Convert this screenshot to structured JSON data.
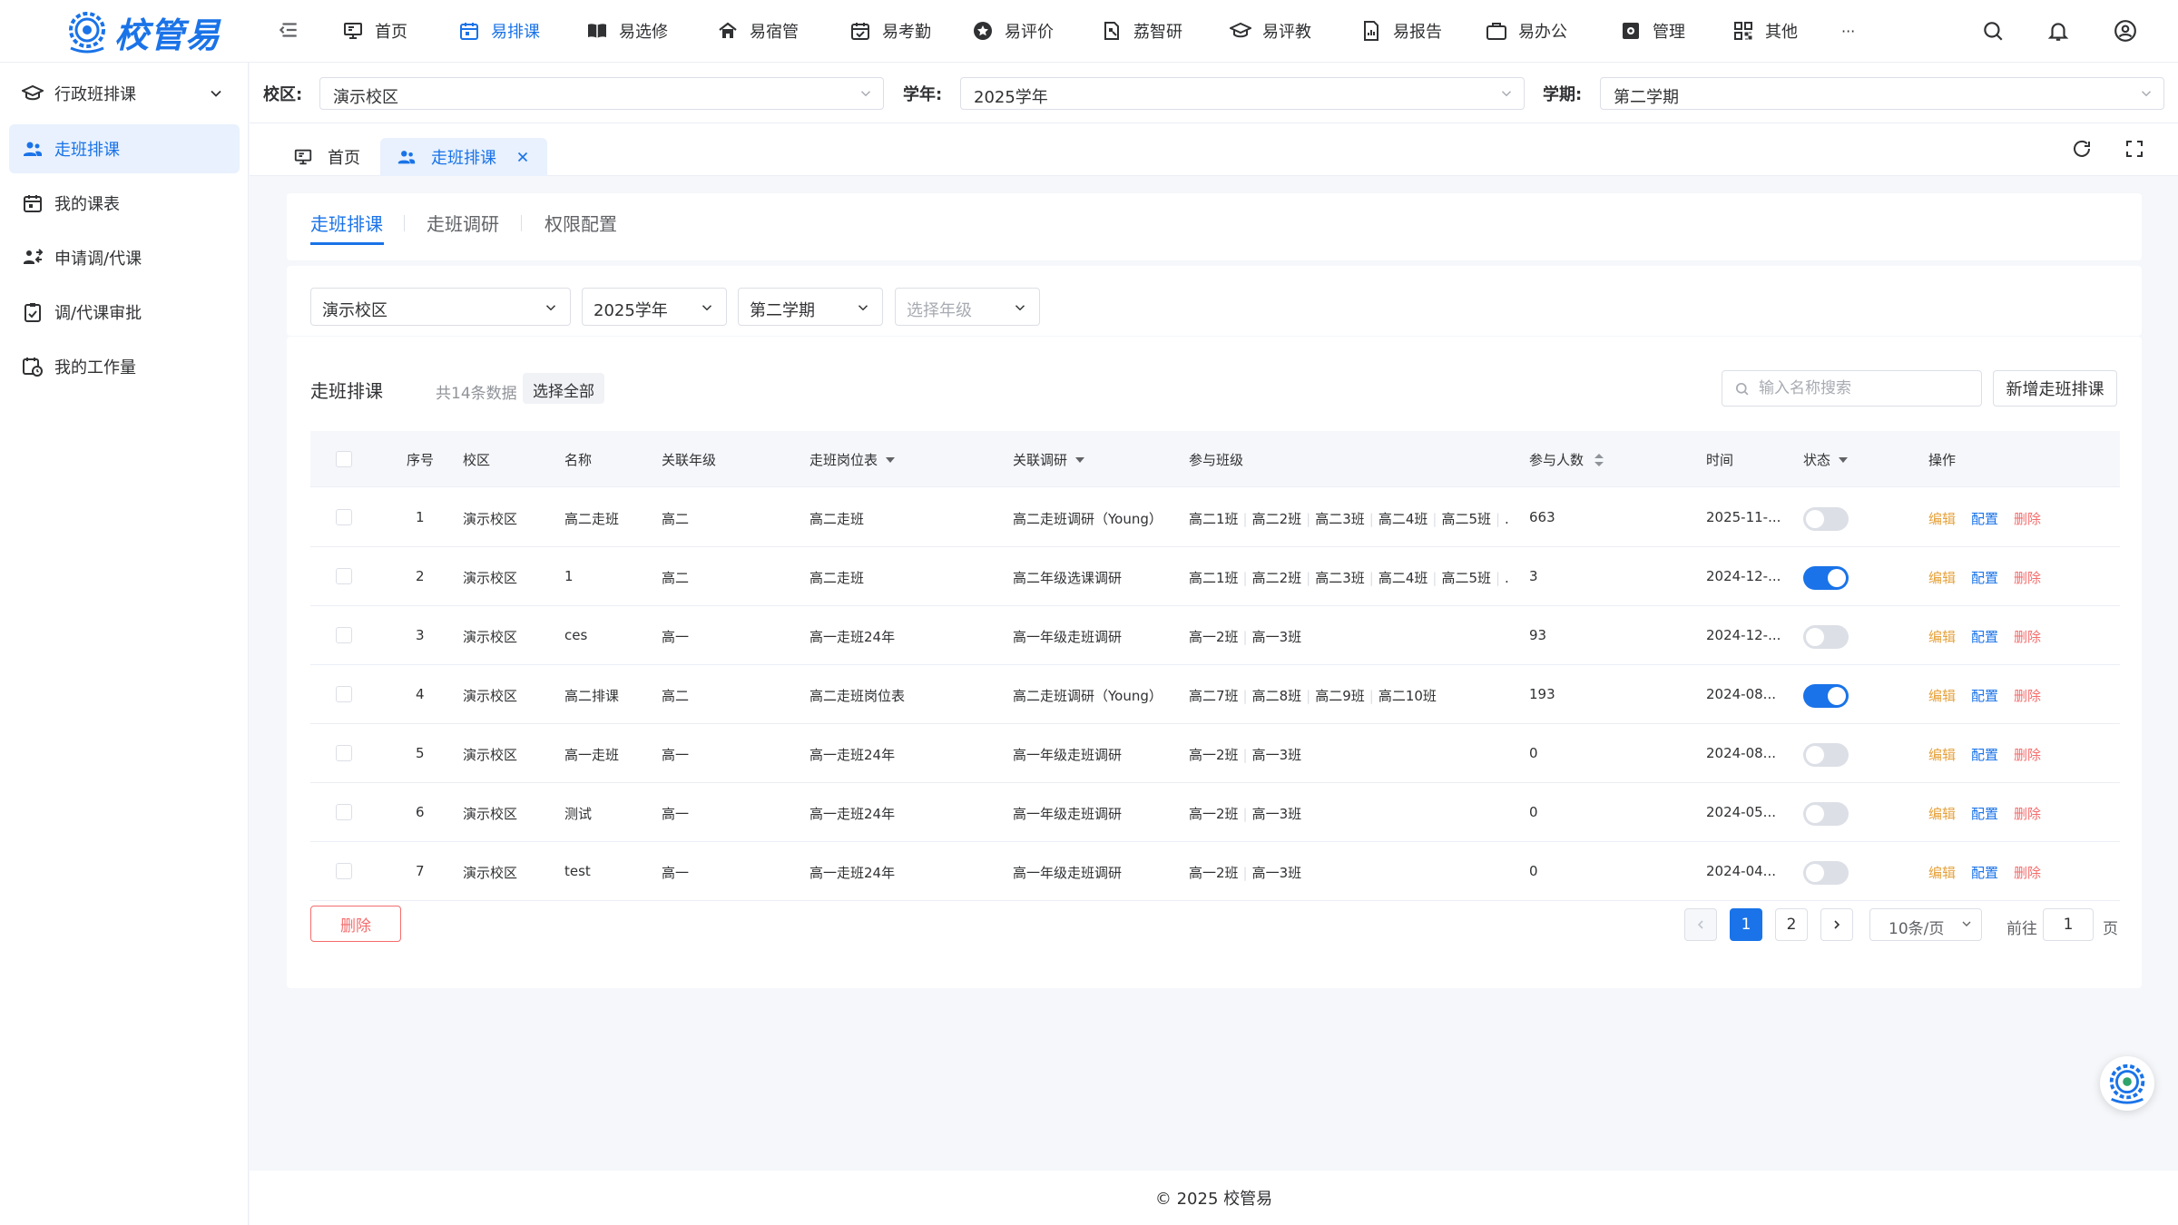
{
  "brand": {
    "name": "校管易"
  },
  "top_nav": [
    {
      "label": "首页",
      "icon": "monitor-icon",
      "active": false
    },
    {
      "label": "易排课",
      "icon": "calendar-icon",
      "active": true
    },
    {
      "label": "易选修",
      "icon": "book-icon",
      "active": false
    },
    {
      "label": "易宿管",
      "icon": "house-icon",
      "active": false
    },
    {
      "label": "易考勤",
      "icon": "calendar-check-icon",
      "active": false
    },
    {
      "label": "易评价",
      "icon": "star-icon",
      "active": false
    },
    {
      "label": "荔智研",
      "icon": "research-icon",
      "active": false
    },
    {
      "label": "易评教",
      "icon": "graduation-cap-icon",
      "active": false
    },
    {
      "label": "易报告",
      "icon": "report-icon",
      "active": false
    },
    {
      "label": "易办公",
      "icon": "briefcase-icon",
      "active": false
    },
    {
      "label": "管理",
      "icon": "gear-icon",
      "active": false
    },
    {
      "label": "其他",
      "icon": "grid-icon",
      "active": false
    }
  ],
  "more_label": "···",
  "sidebar": [
    {
      "label": "行政班排课",
      "icon": "graduation-cap-icon",
      "active": false,
      "expandable": true
    },
    {
      "label": "走班排课",
      "icon": "users-icon",
      "active": true
    },
    {
      "label": "我的课表",
      "icon": "calendar-icon",
      "active": false
    },
    {
      "label": "申请调/代课",
      "icon": "swap-user-icon",
      "active": false
    },
    {
      "label": "调/代课审批",
      "icon": "clipboard-check-icon",
      "active": false
    },
    {
      "label": "我的工作量",
      "icon": "clock-calendar-icon",
      "active": false
    }
  ],
  "filters": {
    "campus_label": "校区:",
    "campus_value": "演示校区",
    "year_label": "学年:",
    "year_value": "2025学年",
    "term_label": "学期:",
    "term_value": "第二学期"
  },
  "page_tabs": [
    {
      "label": "首页",
      "icon": "monitor-icon",
      "active": false
    },
    {
      "label": "走班排课",
      "icon": "users-icon",
      "active": true,
      "closable": true
    }
  ],
  "sub_tabs": [
    {
      "label": "走班排课",
      "active": true
    },
    {
      "label": "走班调研",
      "active": false
    },
    {
      "label": "权限配置",
      "active": false
    }
  ],
  "query": {
    "campus": "演示校区",
    "year": "2025学年",
    "term": "第二学期",
    "grade_placeholder": "选择年级"
  },
  "list": {
    "title": "走班排课",
    "count_text": "共14条数据",
    "select_all_label": "选择全部",
    "search_placeholder": "输入名称搜索",
    "add_label": "新增走班排课",
    "delete_label": "删除"
  },
  "table": {
    "columns": [
      "序号",
      "校区",
      "名称",
      "关联年级",
      "走班岗位表",
      "关联调研",
      "参与班级",
      "参与人数",
      "时间",
      "状态",
      "操作"
    ],
    "actions": {
      "edit": "编辑",
      "config": "配置",
      "delete": "删除"
    },
    "rows": [
      {
        "no": "1",
        "campus": "演示校区",
        "name": "高二走班",
        "grade": "高二",
        "post_table": "高二走班",
        "survey": "高二走班调研（Young）",
        "classes": [
          "高二1班",
          "高二2班",
          "高二3班",
          "高二4班",
          "高二5班"
        ],
        "classes_more": "...",
        "people": "663",
        "time": "2025-11-...",
        "status": false
      },
      {
        "no": "2",
        "campus": "演示校区",
        "name": "1",
        "grade": "高二",
        "post_table": "高二走班",
        "survey": "高二年级选课调研",
        "classes": [
          "高二1班",
          "高二2班",
          "高二3班",
          "高二4班",
          "高二5班"
        ],
        "classes_more": "...",
        "people": "3",
        "time": "2024-12-...",
        "status": true
      },
      {
        "no": "3",
        "campus": "演示校区",
        "name": "ces",
        "grade": "高一",
        "post_table": "高一走班24年",
        "survey": "高一年级走班调研",
        "classes": [
          "高一2班",
          "高一3班"
        ],
        "classes_more": "",
        "people": "93",
        "time": "2024-12-...",
        "status": false
      },
      {
        "no": "4",
        "campus": "演示校区",
        "name": "高二排课",
        "grade": "高二",
        "post_table": "高二走班岗位表",
        "survey": "高二走班调研（Young）",
        "classes": [
          "高二7班",
          "高二8班",
          "高二9班",
          "高二10班"
        ],
        "classes_more": "",
        "people": "193",
        "time": "2024-08...",
        "status": true
      },
      {
        "no": "5",
        "campus": "演示校区",
        "name": "高一走班",
        "grade": "高一",
        "post_table": "高一走班24年",
        "survey": "高一年级走班调研",
        "classes": [
          "高一2班",
          "高一3班"
        ],
        "classes_more": "",
        "people": "0",
        "time": "2024-08...",
        "status": false
      },
      {
        "no": "6",
        "campus": "演示校区",
        "name": "测试",
        "grade": "高一",
        "post_table": "高一走班24年",
        "survey": "高一年级走班调研",
        "classes": [
          "高一2班",
          "高一3班"
        ],
        "classes_more": "",
        "people": "0",
        "time": "2024-05...",
        "status": false
      },
      {
        "no": "7",
        "campus": "演示校区",
        "name": "test",
        "grade": "高一",
        "post_table": "高一走班24年",
        "survey": "高一年级走班调研",
        "classes": [
          "高一2班",
          "高一3班"
        ],
        "classes_more": "",
        "people": "0",
        "time": "2024-04...",
        "status": false
      }
    ]
  },
  "pagination": {
    "pages": [
      "1",
      "2"
    ],
    "current": "1",
    "page_size": "10条/页",
    "goto_label": "前往",
    "goto_value": "1",
    "page_unit": "页"
  },
  "footer": "© 2025 校管易",
  "colors": {
    "primary": "#1a73e8",
    "edit": "#e6a23c",
    "delete": "#f56c6c",
    "active_bg": "#e8f1fd"
  }
}
